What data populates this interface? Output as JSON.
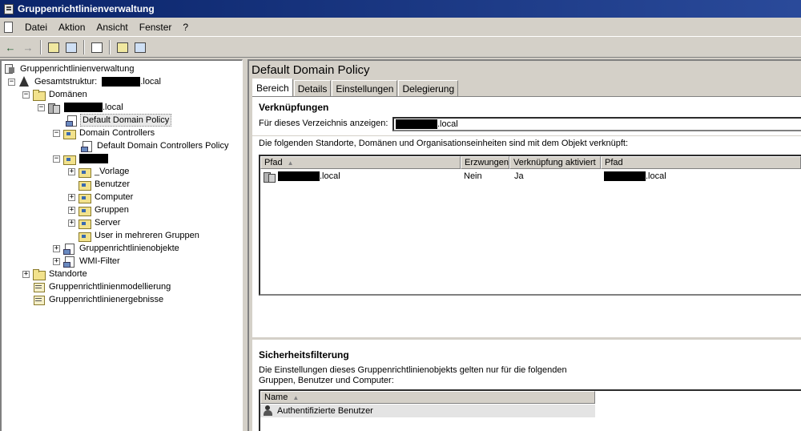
{
  "window": {
    "title": "Gruppenrichtlinienverwaltung"
  },
  "menu": {
    "items": [
      "Datei",
      "Aktion",
      "Ansicht",
      "Fenster",
      "?"
    ]
  },
  "toolbar": {
    "icons": [
      "back-arrow-icon",
      "forward-arrow-icon",
      "up-folder-icon",
      "show-hide-tree-icon",
      "refresh-icon",
      "help-icon",
      "properties-icon"
    ]
  },
  "tree": {
    "root": "Gruppenrichtlinienverwaltung",
    "forest_prefix": "Gesamtstruktur:",
    "forest_suffix": ".local",
    "domains": "Domänen",
    "domain_suffix": ".local",
    "default_policy": "Default Domain Policy",
    "domain_controllers": "Domain Controllers",
    "dc_policy": "Default Domain Controllers Policy",
    "ou_children": [
      "_Vorlage",
      "Benutzer",
      "Computer",
      "Gruppen",
      "Server",
      "User in mehreren Gruppen"
    ],
    "gpo_objects": "Gruppenrichtlinienobjekte",
    "wmi_filter": "WMI-Filter",
    "sites": "Standorte",
    "modeling": "Gruppenrichtlinienmodellierung",
    "results": "Gruppenrichtlinienergebnisse"
  },
  "details": {
    "title": "Default Domain Policy",
    "tabs": [
      "Bereich",
      "Details",
      "Einstellungen",
      "Delegierung"
    ],
    "active_tab": "Bereich",
    "links_title": "Verknüpfungen",
    "show_for_label": "Für dieses Verzeichnis anzeigen:",
    "show_for_suffix": ".local",
    "links_description": "Die folgenden Standorte, Domänen und Organisationseinheiten sind mit dem Objekt verknüpft:",
    "links_columns": [
      "Pfad",
      "Erzwungen",
      "Verknüpfung aktiviert",
      "Pfad"
    ],
    "links_rows": [
      {
        "path_suffix": ".local",
        "enforced": "Nein",
        "enabled": "Ja",
        "path2_suffix": ".local"
      }
    ],
    "security_title": "Sicherheitsfilterung",
    "security_description_1": "Die Einstellungen dieses Gruppenrichtlinienobjekts gelten nur für die folgenden",
    "security_description_2": "Gruppen, Benutzer und Computer:",
    "security_columns": [
      "Name"
    ],
    "security_rows": [
      "Authentifizierte Benutzer"
    ]
  }
}
